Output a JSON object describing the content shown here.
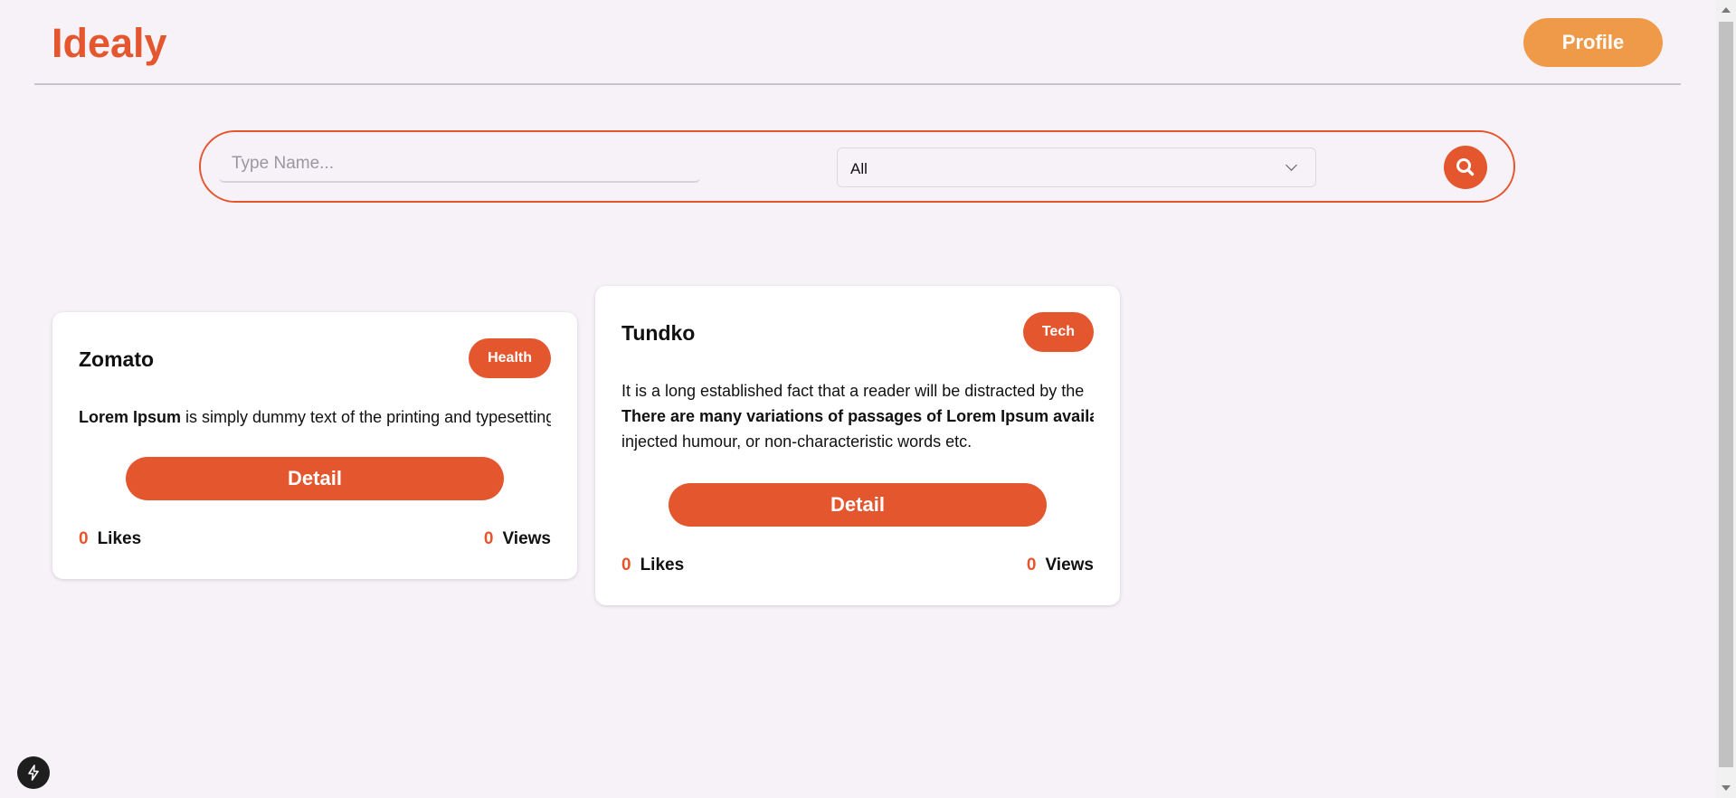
{
  "header": {
    "logo": "Idealy",
    "profile_label": "Profile"
  },
  "search": {
    "placeholder": "Type Name...",
    "category_value": "All",
    "search_icon": "search-icon"
  },
  "cards": [
    {
      "title": "Zomato",
      "badge": "Health",
      "desc_lines": [
        {
          "bold": "Lorem Ipsum",
          "text": " is simply dummy text of the printing and typesetting industry."
        }
      ],
      "button": "Detail",
      "likes": "0",
      "likes_label": "Likes",
      "views": "0",
      "views_label": "Views"
    },
    {
      "title": "Tundko",
      "badge": "Tech",
      "desc_lines": [
        {
          "bold": "",
          "text": "It is a long established fact that a reader will be distracted by the"
        },
        {
          "bold": "There are many variations of passages of Lorem Ipsum available",
          "text": ""
        },
        {
          "bold": "",
          "text": "injected humour, or non-characteristic words etc."
        }
      ],
      "button": "Detail",
      "likes": "0",
      "likes_label": "Likes",
      "views": "0",
      "views_label": "Views"
    }
  ],
  "colors": {
    "accent": "#e4562e",
    "profile": "#ef9a48",
    "background": "#f7f2f8"
  }
}
